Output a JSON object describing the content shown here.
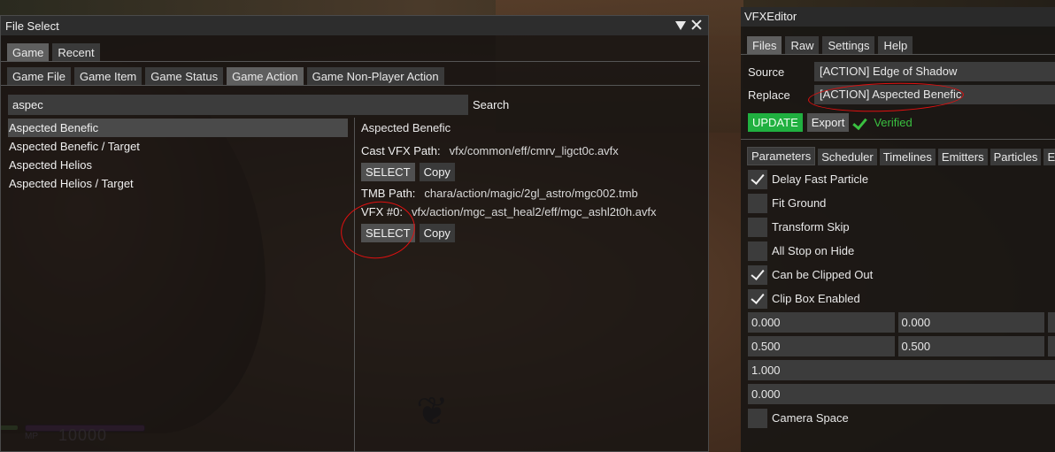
{
  "file_select": {
    "title": "File Select",
    "tabs": [
      "Game",
      "Recent"
    ],
    "subtabs": [
      "Game File",
      "Game Item",
      "Game Status",
      "Game Action",
      "Game Non-Player Action"
    ],
    "search": {
      "value": "aspec",
      "button": "Search"
    },
    "results": [
      "Aspected Benefic",
      "Aspected Benefic / Target",
      "Aspected Helios",
      "Aspected Helios / Target"
    ],
    "detail": {
      "title": "Aspected Benefic",
      "cast_label": "Cast VFX Path:",
      "cast_value": "vfx/common/eff/cmrv_ligct0c.avfx",
      "select_label": "SELECT",
      "copy_label": "Copy",
      "tmb_label": "TMB Path:",
      "tmb_value": "chara/action/magic/2gl_astro/mgc002.tmb",
      "vfx_label": "VFX #0:",
      "vfx_value": "vfx/action/mgc_ast_heal2/eff/mgc_ashl2t0h.avfx"
    }
  },
  "vfx_editor": {
    "title": "VFXEditor",
    "tabs": [
      "Files",
      "Raw",
      "Settings",
      "Help"
    ],
    "source_label": "Source",
    "source_value": "[ACTION] Edge of Shadow",
    "replace_label": "Replace",
    "replace_value": "[ACTION] Aspected Benefic",
    "update_label": "UPDATE",
    "export_label": "Export",
    "verified_label": "Verified",
    "section_tabs": [
      "Parameters",
      "Scheduler",
      "Timelines",
      "Emitters",
      "Particles",
      "E"
    ],
    "checkboxes": [
      {
        "label": "Delay Fast Particle",
        "checked": true
      },
      {
        "label": "Fit Ground",
        "checked": false
      },
      {
        "label": "Transform Skip",
        "checked": false
      },
      {
        "label": "All Stop on Hide",
        "checked": false
      },
      {
        "label": "Can be Clipped Out",
        "checked": true
      },
      {
        "label": "Clip Box Enabled",
        "checked": true
      }
    ],
    "numbers": {
      "row1": [
        "0.000",
        "0.000"
      ],
      "row2": [
        "0.500",
        "0.500"
      ],
      "row3": "1.000",
      "row4": "0.000"
    },
    "camera_space": {
      "label": "Camera Space",
      "checked": false
    }
  },
  "hud": {
    "mp_label": "MP",
    "mp_value": "10000"
  },
  "colors": {
    "annotation": "#e01010",
    "update": "#20b040",
    "verified": "#3ac040"
  }
}
